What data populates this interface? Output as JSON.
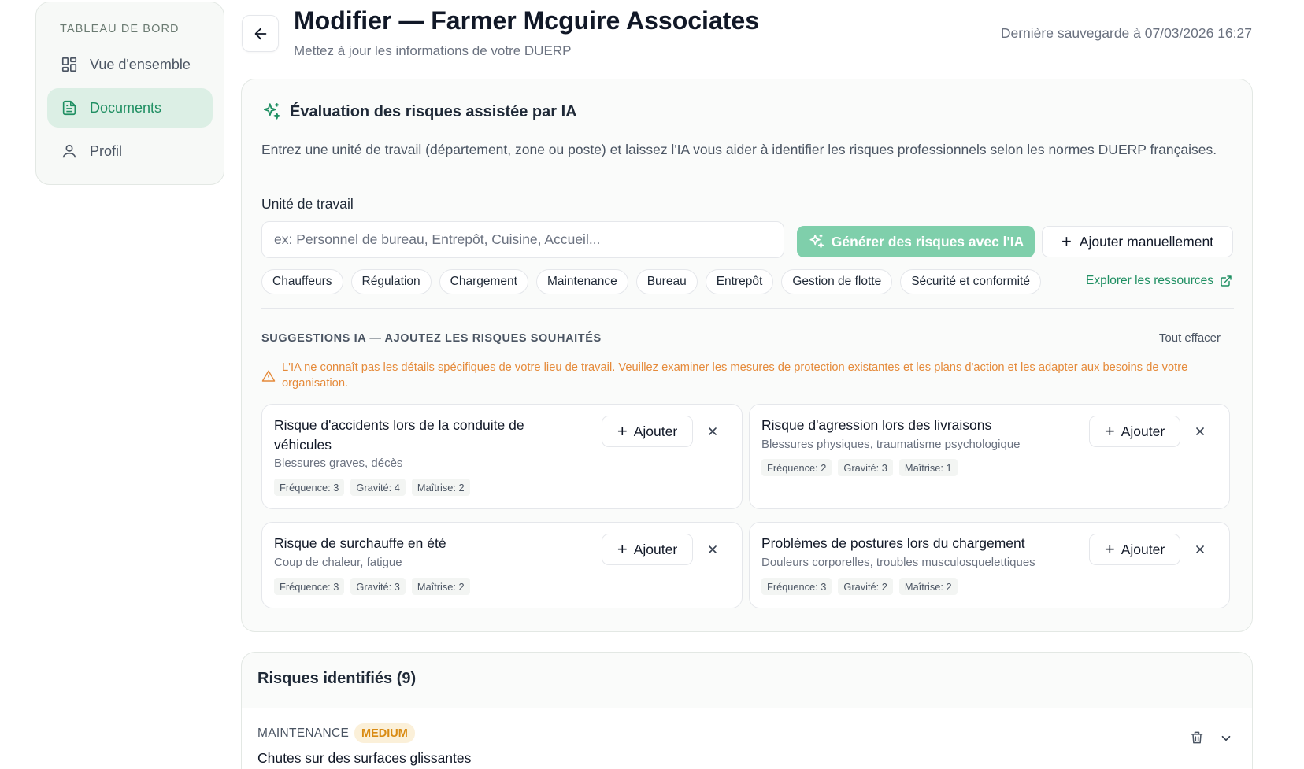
{
  "sidebar": {
    "heading": "TABLEAU DE BORD",
    "items": [
      {
        "label": "Vue d'ensemble",
        "icon": "grid-icon",
        "active": false
      },
      {
        "label": "Documents",
        "icon": "document-icon",
        "active": true
      },
      {
        "label": "Profil",
        "icon": "user-icon",
        "active": false
      }
    ]
  },
  "header": {
    "title": "Modifier — Farmer Mcguire Associates",
    "subtitle": "Mettez à jour les informations de votre DUERP",
    "last_save": "Dernière sauvegarde à 07/03/2026 16:27"
  },
  "ai": {
    "title": "Évaluation des risques assistée par IA",
    "description": "Entrez une unité de travail (département, zone ou poste) et laissez l'IA vous aider à identifier les risques professionnels selon les normes DUERP françaises.",
    "field_label": "Unité de travail",
    "input_value": "",
    "input_placeholder": "ex: Personnel de bureau, Entrepôt, Cuisine, Accueil...",
    "generate_label": "Générer des risques avec l'IA",
    "manual_label": "Ajouter manuellement",
    "chips": [
      "Chauffeurs",
      "Régulation",
      "Chargement",
      "Maintenance",
      "Bureau",
      "Entrepôt",
      "Gestion de flotte",
      "Sécurité et conformité"
    ],
    "explore_label": "Explorer les ressources",
    "suggestions_heading": "SUGGESTIONS IA — AJOUTEZ LES RISQUES SOUHAITÉS",
    "clear_all_label": "Tout effacer",
    "warning": "L'IA ne connaît pas les détails spécifiques de votre lieu de travail. Veuillez examiner les mesures de protection existantes et les plans d'action et les adapter aux besoins de votre organisation.",
    "add_label": "Ajouter",
    "suggestions": [
      {
        "title": "Risque d'accidents lors de la conduite de véhicules",
        "subtitle": "Blessures graves, décès",
        "frequence": "Fréquence: 3",
        "gravite": "Gravité: 4",
        "maitrise": "Maîtrise: 2"
      },
      {
        "title": "Risque d'agression lors des livraisons",
        "subtitle": "Blessures physiques, traumatisme psychologique",
        "frequence": "Fréquence: 2",
        "gravite": "Gravité: 3",
        "maitrise": "Maîtrise: 1"
      },
      {
        "title": "Risque de surchauffe en été",
        "subtitle": "Coup de chaleur, fatigue",
        "frequence": "Fréquence: 3",
        "gravite": "Gravité: 3",
        "maitrise": "Maîtrise: 2"
      },
      {
        "title": "Problèmes de postures lors du chargement",
        "subtitle": "Douleurs corporelles, troubles musculosquelettiques",
        "frequence": "Fréquence: 3",
        "gravite": "Gravité: 2",
        "maitrise": "Maîtrise: 2"
      }
    ]
  },
  "identified": {
    "title": "Risques identifiés (9)",
    "rows": [
      {
        "category": "MAINTENANCE",
        "level": "MEDIUM",
        "title": "Chutes sur des surfaces glissantes"
      }
    ]
  },
  "colors": {
    "accent": "#1f8f62",
    "accent_light": "#dcefe5",
    "generate_button": "#7fcfab",
    "warning": "#e58a3a",
    "medium_badge_bg": "#fbf0d9",
    "medium_badge_text": "#d98b13"
  }
}
